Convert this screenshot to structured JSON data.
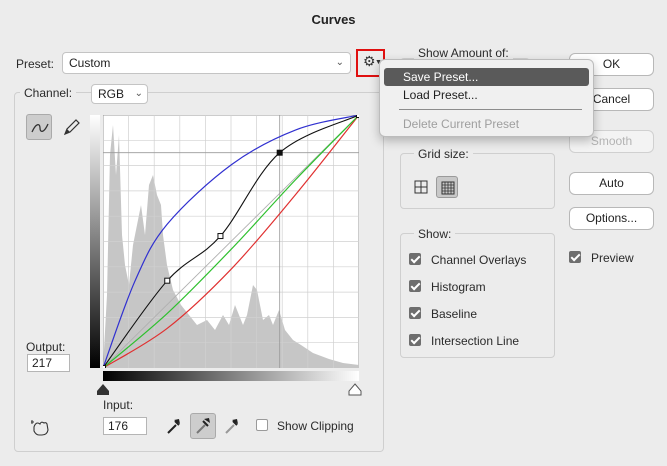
{
  "dialog": {
    "title": "Curves"
  },
  "preset": {
    "label": "Preset:",
    "value": "Custom"
  },
  "menu": {
    "items": [
      {
        "label": "Save Preset...",
        "state": "highlighted"
      },
      {
        "label": "Load Preset...",
        "state": "enabled"
      },
      {
        "label": "Delete Current Preset",
        "state": "disabled"
      }
    ]
  },
  "channel": {
    "label": "Channel:",
    "value": "RGB"
  },
  "show_amount": {
    "legend": "Show Amount of:"
  },
  "grid_size": {
    "legend": "Grid size:",
    "icons": [
      "simple-grid-icon",
      "detailed-grid-icon"
    ]
  },
  "show": {
    "legend": "Show:",
    "options": [
      {
        "label": "Channel Overlays",
        "checked": true
      },
      {
        "label": "Histogram",
        "checked": true
      },
      {
        "label": "Baseline",
        "checked": true
      },
      {
        "label": "Intersection Line",
        "checked": true
      }
    ]
  },
  "buttons": {
    "ok": "OK",
    "cancel": "Cancel",
    "smooth": "Smooth",
    "auto": "Auto",
    "options": "Options..."
  },
  "preview": {
    "label": "Preview",
    "checked": true
  },
  "output": {
    "label": "Output:",
    "value": "217"
  },
  "input": {
    "label": "Input:",
    "value": "176"
  },
  "show_clipping": {
    "label": "Show Clipping",
    "checked": false
  },
  "tools": [
    "curve-point-icon",
    "pencil-icon"
  ],
  "eyedroppers": [
    "black-point-eyedropper-icon",
    "gray-point-eyedropper-icon",
    "white-point-eyedropper-icon"
  ],
  "colors": {
    "red": "#e03030",
    "green": "#2ec02e",
    "blue": "#3030d0",
    "composite": "#111111",
    "highlight": "#5a5a5a",
    "focus_ring": "#e01010"
  },
  "curve_chart": {
    "range": [
      0,
      255
    ],
    "composite_points": [
      [
        0,
        0
      ],
      [
        64,
        88
      ],
      [
        117,
        133
      ],
      [
        176,
        217
      ],
      [
        255,
        255
      ]
    ],
    "red_curve": [
      [
        0,
        0
      ],
      [
        64,
        40
      ],
      [
        128,
        100
      ],
      [
        192,
        175
      ],
      [
        255,
        255
      ]
    ],
    "green_curve": [
      [
        0,
        0
      ],
      [
        64,
        55
      ],
      [
        128,
        120
      ],
      [
        192,
        190
      ],
      [
        255,
        255
      ]
    ],
    "blue_curve": [
      [
        0,
        0
      ],
      [
        32,
        88
      ],
      [
        64,
        145
      ],
      [
        128,
        205
      ],
      [
        192,
        240
      ],
      [
        255,
        255
      ]
    ]
  }
}
